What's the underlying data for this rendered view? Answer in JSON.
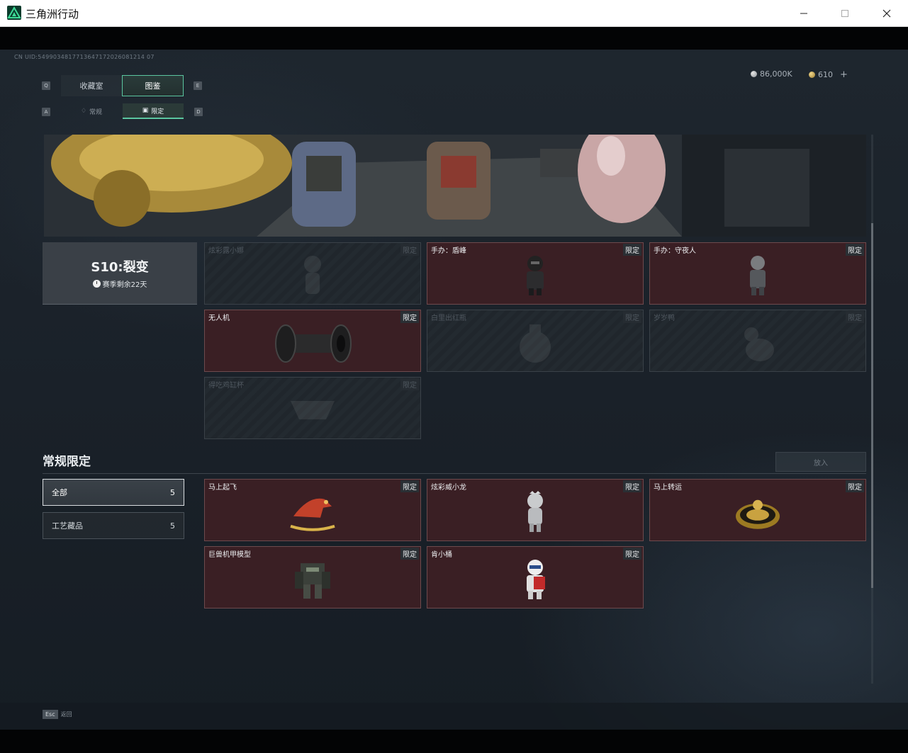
{
  "window": {
    "title": "三角洲行动"
  },
  "header": {
    "uid": "CN UID:5499034817713647172026081214 07",
    "currency_silver": "86,000K",
    "currency_gold": "610",
    "add_label": "+"
  },
  "keys": {
    "q": "Q",
    "e": "E",
    "a": "A",
    "d": "D",
    "esc": "Esc"
  },
  "tabs": [
    {
      "label": "收藏室"
    },
    {
      "label": "图鉴"
    }
  ],
  "subtabs": [
    {
      "label": "常规"
    },
    {
      "label": "限定"
    }
  ],
  "season": {
    "title": "S10:裂变",
    "remaining": "赛季剩余22天"
  },
  "season_items": [
    {
      "name": "炫彩露小娜",
      "tag": "限定",
      "owned": false
    },
    {
      "name": "手办：盾峰",
      "tag": "限定",
      "owned": true
    },
    {
      "name": "手办：守夜人",
      "tag": "限定",
      "owned": true
    },
    {
      "name": "无人机",
      "tag": "限定",
      "owned": true
    },
    {
      "name": "白里出红瓶",
      "tag": "限定",
      "owned": false
    },
    {
      "name": "岁岁鸭",
      "tag": "限定",
      "owned": false
    },
    {
      "name": "得吃鸡缸杯",
      "tag": "限定",
      "owned": false
    }
  ],
  "section": {
    "title": "常规限定",
    "batch_label": "放入"
  },
  "filters": [
    {
      "label": "全部",
      "count": "5"
    },
    {
      "label": "工艺藏品",
      "count": "5"
    }
  ],
  "regular_items": [
    {
      "name": "马上起飞",
      "tag": "限定"
    },
    {
      "name": "炫彩威小龙",
      "tag": "限定"
    },
    {
      "name": "马上转运",
      "tag": "限定"
    },
    {
      "name": "巨兽机甲模型",
      "tag": "限定"
    },
    {
      "name": "肯小桶",
      "tag": "限定"
    }
  ],
  "footer": {
    "back_label": "返回"
  }
}
